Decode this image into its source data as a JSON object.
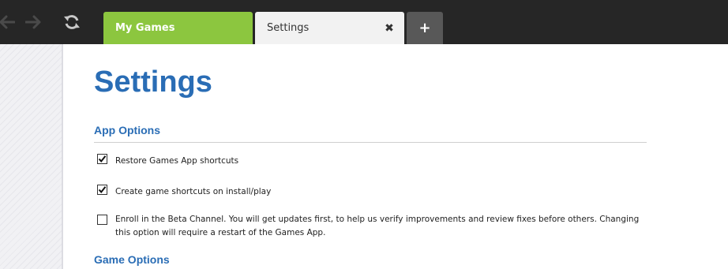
{
  "toolbar": {
    "back_icon": "arrow-left-icon",
    "forward_icon": "arrow-right-icon",
    "refresh_icon": "refresh-icon"
  },
  "tabs": [
    {
      "label": "My Games",
      "active_color": "#8cc63f"
    },
    {
      "label": "Settings",
      "close_label": "✖"
    },
    {
      "label": "+"
    }
  ],
  "page": {
    "title": "Settings"
  },
  "sections": [
    {
      "title": "App Options",
      "options": [
        {
          "label": "Restore Games App shortcuts",
          "checked": true
        },
        {
          "label": "Create game shortcuts on install/play",
          "checked": true
        },
        {
          "label": "Enroll in the Beta Channel. You will get updates first, to help us verify improvements and review fixes before others. Changing this option will require a restart of the Games App.",
          "checked": false
        }
      ]
    },
    {
      "title": "Game Options"
    }
  ],
  "colors": {
    "accent": "#2a6db5",
    "topbar": "#262626",
    "tab_active": "#8cc63f"
  }
}
